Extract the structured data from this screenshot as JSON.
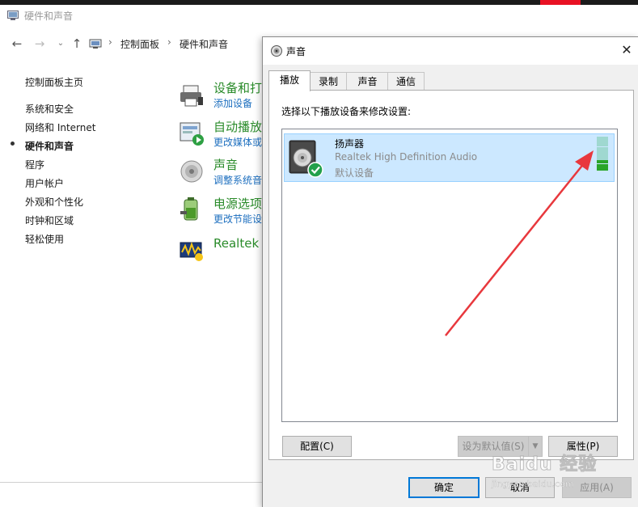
{
  "colors": {
    "accent": "#0078d7",
    "link": "#1d6fbf",
    "category_title": "#2a8b2a",
    "selection_bg": "#cce8ff",
    "vu_active": "#2aa52a",
    "vu_idle": "#9fd8d0",
    "annotation_arrow": "#e8383d"
  },
  "control_panel": {
    "window_title": "硬件和声音",
    "title_icon": "control-panel-icon",
    "breadcrumb": [
      "控制面板",
      "硬件和声音"
    ],
    "sidebar": {
      "home": "控制面板主页",
      "items": [
        {
          "label": "系统和安全"
        },
        {
          "label": "网络和 Internet"
        },
        {
          "label": "硬件和声音",
          "current": true
        },
        {
          "label": "程序"
        },
        {
          "label": "用户帐户"
        },
        {
          "label": "外观和个性化"
        },
        {
          "label": "时钟和区域"
        },
        {
          "label": "轻松使用"
        }
      ]
    },
    "categories": [
      {
        "title": "设备和打",
        "link": "添加设备",
        "icon": "printer-icon"
      },
      {
        "title": "自动播放",
        "link": "更改媒体或",
        "icon": "autoplay-icon"
      },
      {
        "title": "声音",
        "link": "调整系统音",
        "icon": "speaker-icon"
      },
      {
        "title": "电源选项",
        "link": "更改节能设",
        "icon": "battery-icon"
      },
      {
        "title": "Realtek",
        "link": "",
        "icon": "realtek-audio-icon"
      }
    ]
  },
  "sound_dialog": {
    "title": "声音",
    "icon": "speaker-icon",
    "tabs": [
      "播放",
      "录制",
      "声音",
      "通信"
    ],
    "active_tab": "播放",
    "instruction": "选择以下播放设备来修改设置:",
    "devices": [
      {
        "name": "扬声器",
        "description": "Realtek High Definition Audio",
        "status": "默认设备",
        "selected": true,
        "is_default": true,
        "level_bars_active": 3,
        "level_bars_total": 10
      }
    ],
    "buttons": {
      "configure": "配置(C)",
      "set_default": "设为默认值(S)",
      "properties": "属性(P)",
      "ok": "确定",
      "cancel": "取消",
      "apply": "应用(A)"
    }
  },
  "watermark": {
    "main": "Baidu 经验",
    "sub": "jingyan.baidu.com"
  }
}
